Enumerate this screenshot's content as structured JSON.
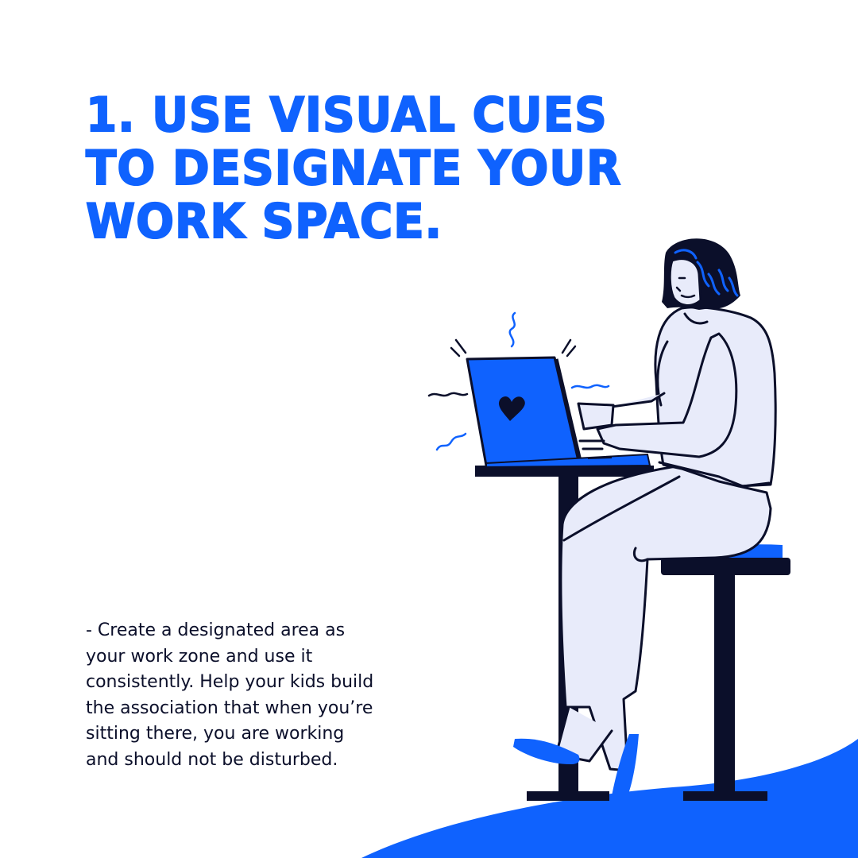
{
  "headline": {
    "lines": [
      "1. USE VISUAL CUES",
      "TO DESIGNATE YOUR",
      "WORK SPACE."
    ]
  },
  "body": {
    "lines": [
      "- Create a designated area as",
      "your work zone and use it",
      "consistently. Help your kids build",
      "the association that when you’re",
      "sitting there, you are working",
      "and should not be disturbed."
    ]
  },
  "colors": {
    "accent": "#0f62fe",
    "ink": "#0b0f2a",
    "figure": "#e8ebfa"
  },
  "illustration": {
    "subject": "woman-working-on-laptop",
    "laptop_icon": "heart-icon"
  }
}
